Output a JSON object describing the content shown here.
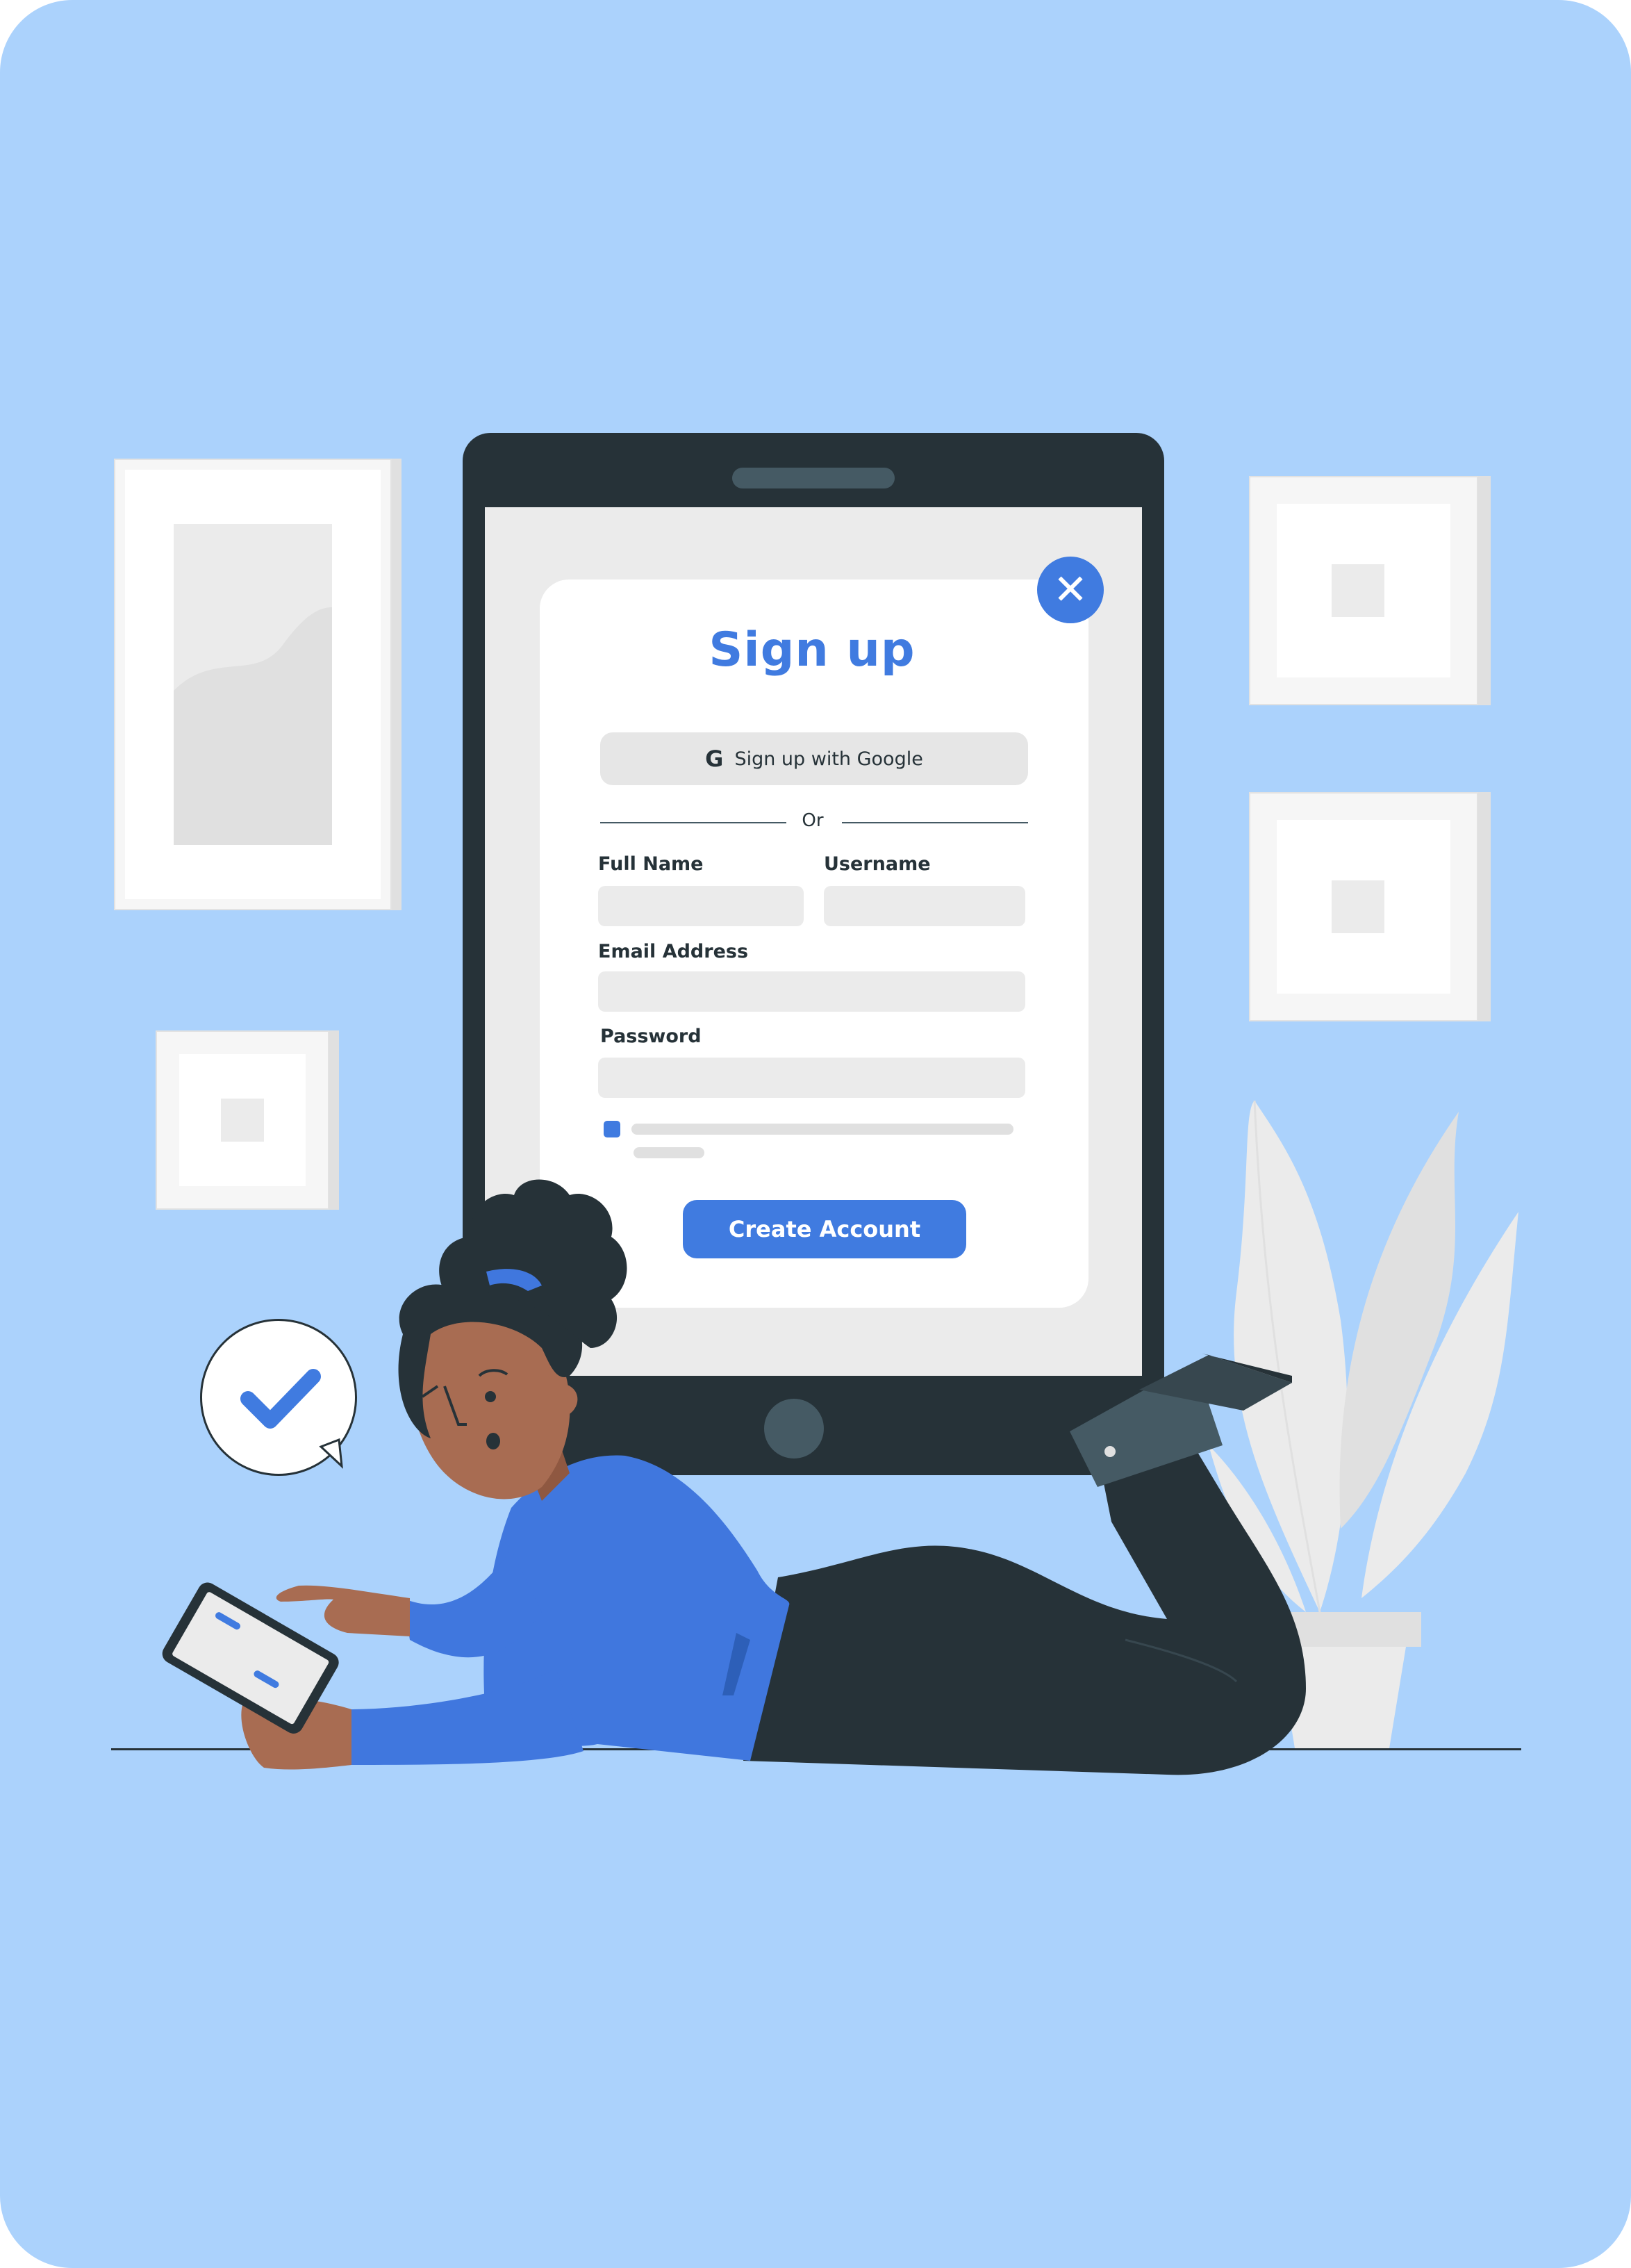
{
  "dialog": {
    "title": "Sign up",
    "close_icon": "close-icon",
    "google_button": {
      "icon": "google-g-icon",
      "glyph": "G",
      "label": "Sign up with Google"
    },
    "separator": "Or",
    "fields": {
      "full_name_label": "Full Name",
      "username_label": "Username",
      "email_label": "Email Address",
      "password_label": "Password"
    },
    "terms_checkbox_checked": true,
    "create_button": "Create Account"
  },
  "decor": {
    "bubble_icon": "checkmark-icon",
    "plant_icon": "plant-icon"
  },
  "colors": {
    "background": "#abd2fc",
    "accent": "#407be0",
    "dark": "#263238",
    "field": "#ebebeb",
    "skin": "#a86c52",
    "sweater": "#4077de"
  }
}
